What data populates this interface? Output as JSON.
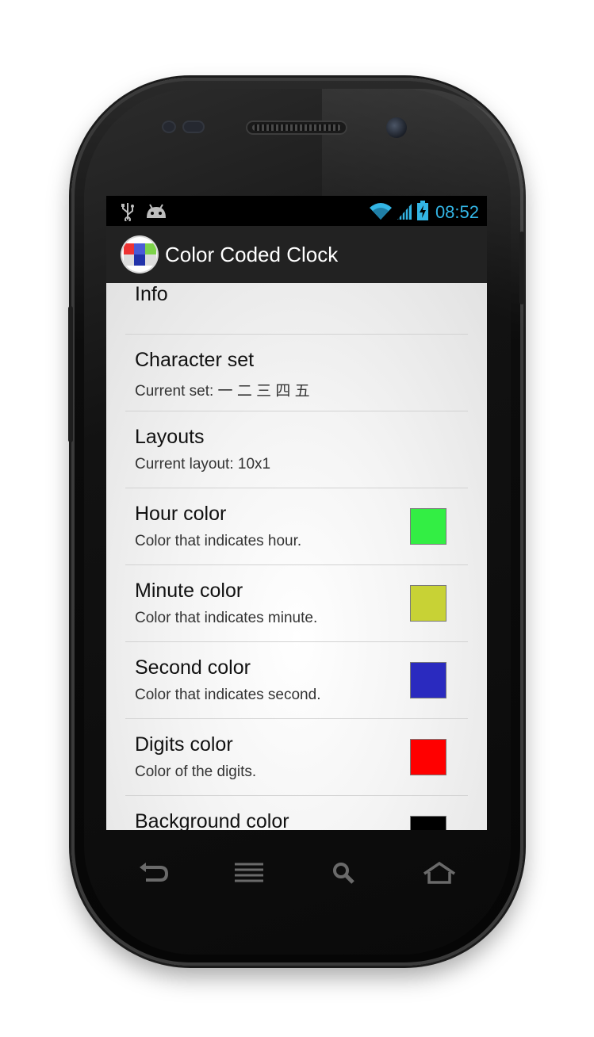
{
  "statusbar": {
    "icons": [
      "usb-icon",
      "android-debug-icon",
      "wifi-icon",
      "signal-icon",
      "battery-charging-icon"
    ],
    "time": "08:52",
    "time_color": "#33b5e5"
  },
  "actionbar": {
    "app_icon": "color-coded-clock-app-icon",
    "title": "Color Coded Clock",
    "background": "#222222"
  },
  "preferences": [
    {
      "id": "info",
      "title": "Info",
      "summary": ""
    },
    {
      "id": "character-set",
      "title": "Character set",
      "summary": "Current set: 一 二 三 四 五"
    },
    {
      "id": "layouts",
      "title": "Layouts",
      "summary": "Current layout: 10x1"
    },
    {
      "id": "hour-color",
      "title": "Hour color",
      "summary": "Color that indicates hour.",
      "swatch": "#33ee44"
    },
    {
      "id": "minute-color",
      "title": "Minute color",
      "summary": "Color that indicates minute.",
      "swatch": "#c8d235"
    },
    {
      "id": "second-color",
      "title": "Second color",
      "summary": "Color that indicates second.",
      "swatch": "#2a2abf"
    },
    {
      "id": "digits-color",
      "title": "Digits color",
      "summary": "Color of the digits.",
      "swatch": "#ff0000"
    },
    {
      "id": "background-color",
      "title": "Background color",
      "summary": "",
      "swatch": "#000000"
    }
  ],
  "navbar": {
    "buttons": [
      "back-icon",
      "menu-icon",
      "search-icon",
      "home-icon"
    ]
  }
}
